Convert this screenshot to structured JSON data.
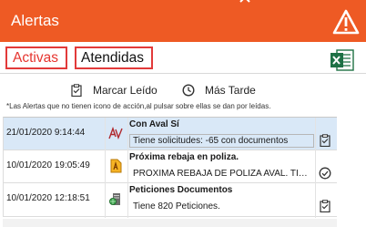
{
  "window": {
    "title": "Alertas",
    "accent": "#ee5a24"
  },
  "tabs": [
    {
      "label": "Activas",
      "selected": true
    },
    {
      "label": "Atendidas",
      "selected": false
    }
  ],
  "toolbar": {
    "mark_read_label": "Marcar Leído",
    "later_label": "Más Tarde",
    "export_icon": "excel-icon"
  },
  "note": "*Las Alertas que no tienen icono de acción,al pulsar sobre ellas se dan por leídas.",
  "alerts": [
    {
      "date": "21/01/2020 9:14:44",
      "icon": "signature-av-icon",
      "subject": "Con Aval Sí",
      "body": "Tiene solicitudes:       -65 con documentos",
      "status_icon": "clipboard-icon",
      "selected": true
    },
    {
      "date": "10/01/2020 19:05:49",
      "icon": "pdf-document-icon",
      "subject": "Próxima rebaja en poliza.",
      "body": "PROXIMA REBAJA DE POLIZA AVAL. TIENE",
      "status_icon": "check-circle-icon",
      "selected": false
    },
    {
      "date": "10/01/2020 12:18:51",
      "icon": "globe-server-icon",
      "subject": "Peticiones Documentos",
      "body": "Tiene 820 Peticiones.",
      "status_icon": "clipboard-icon",
      "selected": false
    }
  ]
}
